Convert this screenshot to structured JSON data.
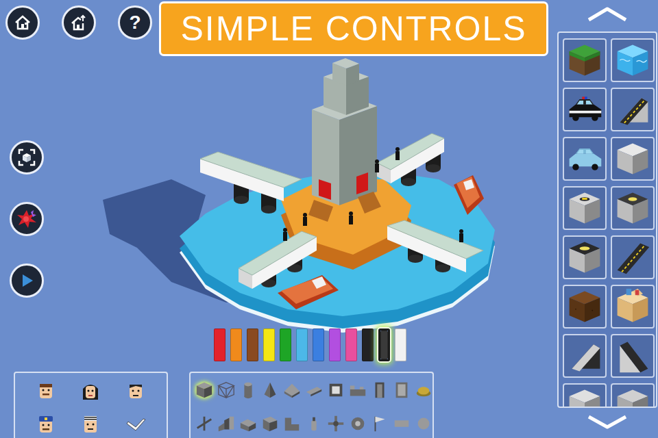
{
  "banner": {
    "title": "SIMPLE CONTROLS"
  },
  "toolbar": {
    "help": "?"
  },
  "colors": [
    {
      "color": "#e3222b",
      "selected": false
    },
    {
      "color": "#f08a1c",
      "selected": false
    },
    {
      "color": "#8a4a1f",
      "selected": false
    },
    {
      "color": "#f4e614",
      "selected": false
    },
    {
      "color": "#1ea526",
      "selected": false
    },
    {
      "color": "#4cb8e8",
      "selected": false
    },
    {
      "color": "#3b7fe0",
      "selected": false
    },
    {
      "color": "#b24fe0",
      "selected": false
    },
    {
      "color": "#e84f9e",
      "selected": false
    },
    {
      "color": "#222222",
      "selected": false
    },
    {
      "color": "#3a3a3a",
      "selected": true
    },
    {
      "color": "#f2f2f2",
      "selected": false
    }
  ],
  "shapes": [
    {
      "selected": true
    },
    {
      "selected": false
    },
    {
      "selected": false
    },
    {
      "selected": false
    },
    {
      "selected": false
    },
    {
      "selected": false
    },
    {
      "selected": false
    },
    {
      "selected": false
    },
    {
      "selected": false
    },
    {
      "selected": false
    },
    {
      "selected": false
    },
    {
      "selected": false
    },
    {
      "selected": false
    },
    {
      "selected": false
    },
    {
      "selected": false
    },
    {
      "selected": false
    },
    {
      "selected": false
    },
    {
      "selected": false
    },
    {
      "selected": false
    },
    {
      "selected": false
    },
    {
      "selected": false
    },
    {
      "selected": false
    }
  ],
  "blocks": [
    {
      "selected": false
    },
    {
      "selected": false
    },
    {
      "selected": false
    },
    {
      "selected": false
    },
    {
      "selected": false
    },
    {
      "selected": false
    },
    {
      "selected": false
    },
    {
      "selected": false
    },
    {
      "selected": false
    },
    {
      "selected": false
    },
    {
      "selected": false
    },
    {
      "selected": false
    },
    {
      "selected": false
    },
    {
      "selected": false
    },
    {
      "selected": false
    },
    {
      "selected": false
    }
  ],
  "characters": [
    {
      "selected": false
    },
    {
      "selected": false
    },
    {
      "selected": false
    },
    {
      "selected": false
    },
    {
      "selected": false
    },
    {
      "selected": false
    }
  ]
}
